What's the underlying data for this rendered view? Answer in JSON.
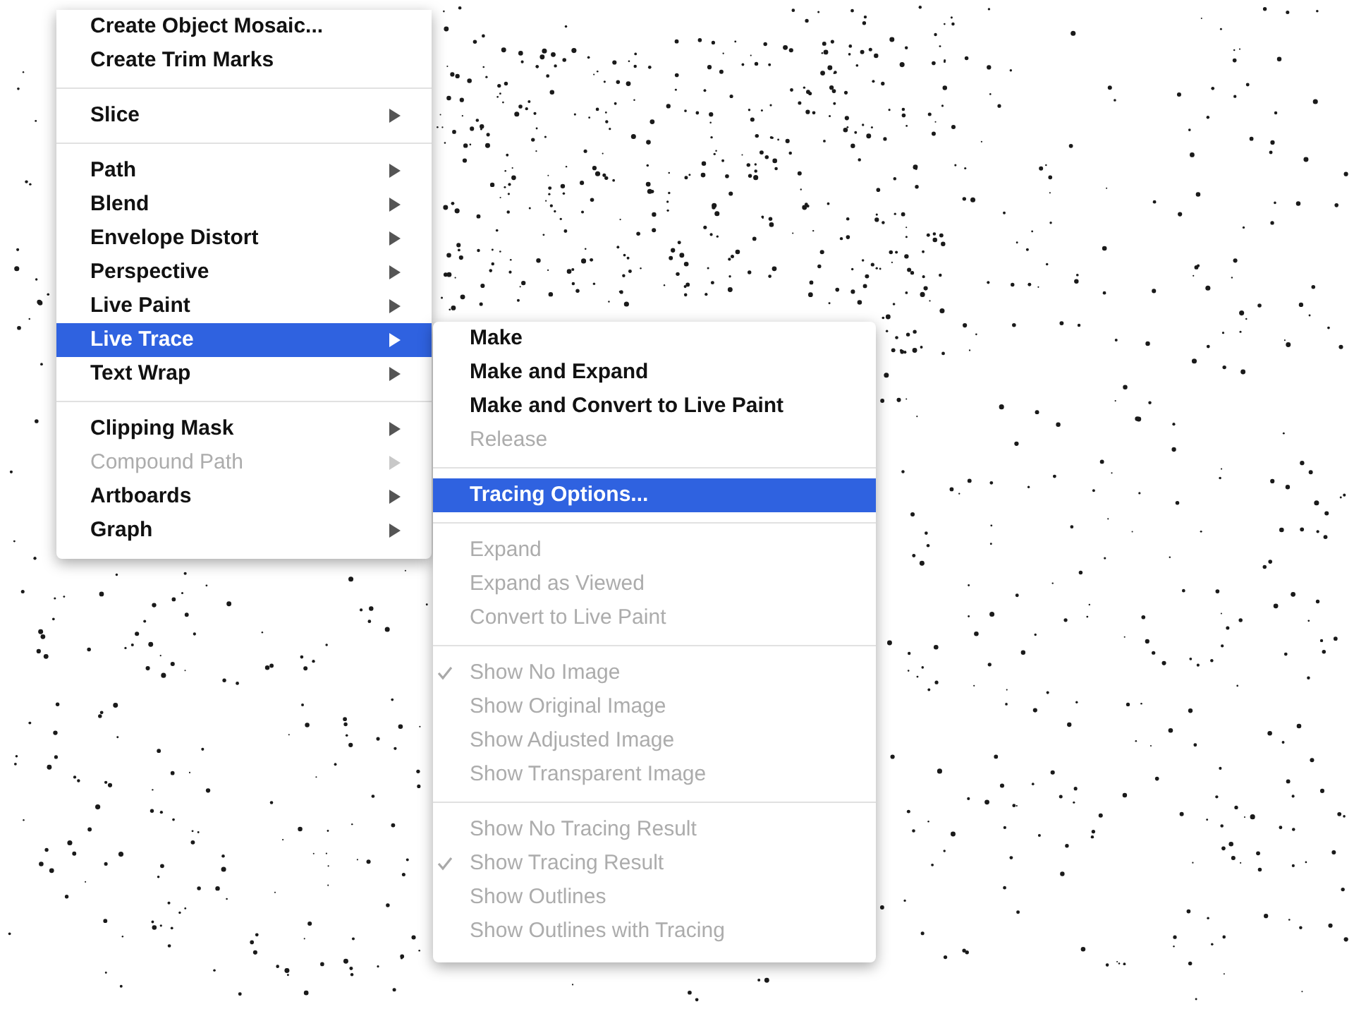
{
  "main_menu": {
    "items": [
      {
        "kind": "item",
        "label": "Create Object Mosaic...",
        "disabled": false,
        "selected": false,
        "has_submenu": false
      },
      {
        "kind": "item",
        "label": "Create Trim Marks",
        "disabled": false,
        "selected": false,
        "has_submenu": false
      },
      {
        "kind": "separator"
      },
      {
        "kind": "item",
        "label": "Slice",
        "disabled": false,
        "selected": false,
        "has_submenu": true
      },
      {
        "kind": "separator"
      },
      {
        "kind": "item",
        "label": "Path",
        "disabled": false,
        "selected": false,
        "has_submenu": true
      },
      {
        "kind": "item",
        "label": "Blend",
        "disabled": false,
        "selected": false,
        "has_submenu": true
      },
      {
        "kind": "item",
        "label": "Envelope Distort",
        "disabled": false,
        "selected": false,
        "has_submenu": true
      },
      {
        "kind": "item",
        "label": "Perspective",
        "disabled": false,
        "selected": false,
        "has_submenu": true
      },
      {
        "kind": "item",
        "label": "Live Paint",
        "disabled": false,
        "selected": false,
        "has_submenu": true
      },
      {
        "kind": "item",
        "label": "Live Trace",
        "disabled": false,
        "selected": true,
        "has_submenu": true
      },
      {
        "kind": "item",
        "label": "Text Wrap",
        "disabled": false,
        "selected": false,
        "has_submenu": true
      },
      {
        "kind": "separator"
      },
      {
        "kind": "item",
        "label": "Clipping Mask",
        "disabled": false,
        "selected": false,
        "has_submenu": true
      },
      {
        "kind": "item",
        "label": "Compound Path",
        "disabled": true,
        "selected": false,
        "has_submenu": true
      },
      {
        "kind": "item",
        "label": "Artboards",
        "disabled": false,
        "selected": false,
        "has_submenu": true
      },
      {
        "kind": "item",
        "label": "Graph",
        "disabled": false,
        "selected": false,
        "has_submenu": true
      }
    ]
  },
  "submenu": {
    "items": [
      {
        "kind": "item",
        "label": "Make",
        "disabled": false,
        "selected": false,
        "checked": false
      },
      {
        "kind": "item",
        "label": "Make and Expand",
        "disabled": false,
        "selected": false,
        "checked": false
      },
      {
        "kind": "item",
        "label": "Make and Convert to Live Paint",
        "disabled": false,
        "selected": false,
        "checked": false
      },
      {
        "kind": "item",
        "label": "Release",
        "disabled": true,
        "selected": false,
        "checked": false
      },
      {
        "kind": "separator"
      },
      {
        "kind": "item",
        "label": "Tracing Options...",
        "disabled": false,
        "selected": true,
        "checked": false
      },
      {
        "kind": "separator"
      },
      {
        "kind": "item",
        "label": "Expand",
        "disabled": true,
        "selected": false,
        "checked": false
      },
      {
        "kind": "item",
        "label": "Expand as Viewed",
        "disabled": true,
        "selected": false,
        "checked": false
      },
      {
        "kind": "item",
        "label": "Convert to Live Paint",
        "disabled": true,
        "selected": false,
        "checked": false
      },
      {
        "kind": "separator"
      },
      {
        "kind": "item",
        "label": "Show No Image",
        "disabled": true,
        "selected": false,
        "checked": true
      },
      {
        "kind": "item",
        "label": "Show Original Image",
        "disabled": true,
        "selected": false,
        "checked": false
      },
      {
        "kind": "item",
        "label": "Show Adjusted Image",
        "disabled": true,
        "selected": false,
        "checked": false
      },
      {
        "kind": "item",
        "label": "Show Transparent Image",
        "disabled": true,
        "selected": false,
        "checked": false
      },
      {
        "kind": "separator"
      },
      {
        "kind": "item",
        "label": "Show No Tracing Result",
        "disabled": true,
        "selected": false,
        "checked": false
      },
      {
        "kind": "item",
        "label": "Show Tracing Result",
        "disabled": true,
        "selected": false,
        "checked": true
      },
      {
        "kind": "item",
        "label": "Show Outlines",
        "disabled": true,
        "selected": false,
        "checked": false
      },
      {
        "kind": "item",
        "label": "Show Outlines with Tracing",
        "disabled": true,
        "selected": false,
        "checked": false
      }
    ]
  }
}
